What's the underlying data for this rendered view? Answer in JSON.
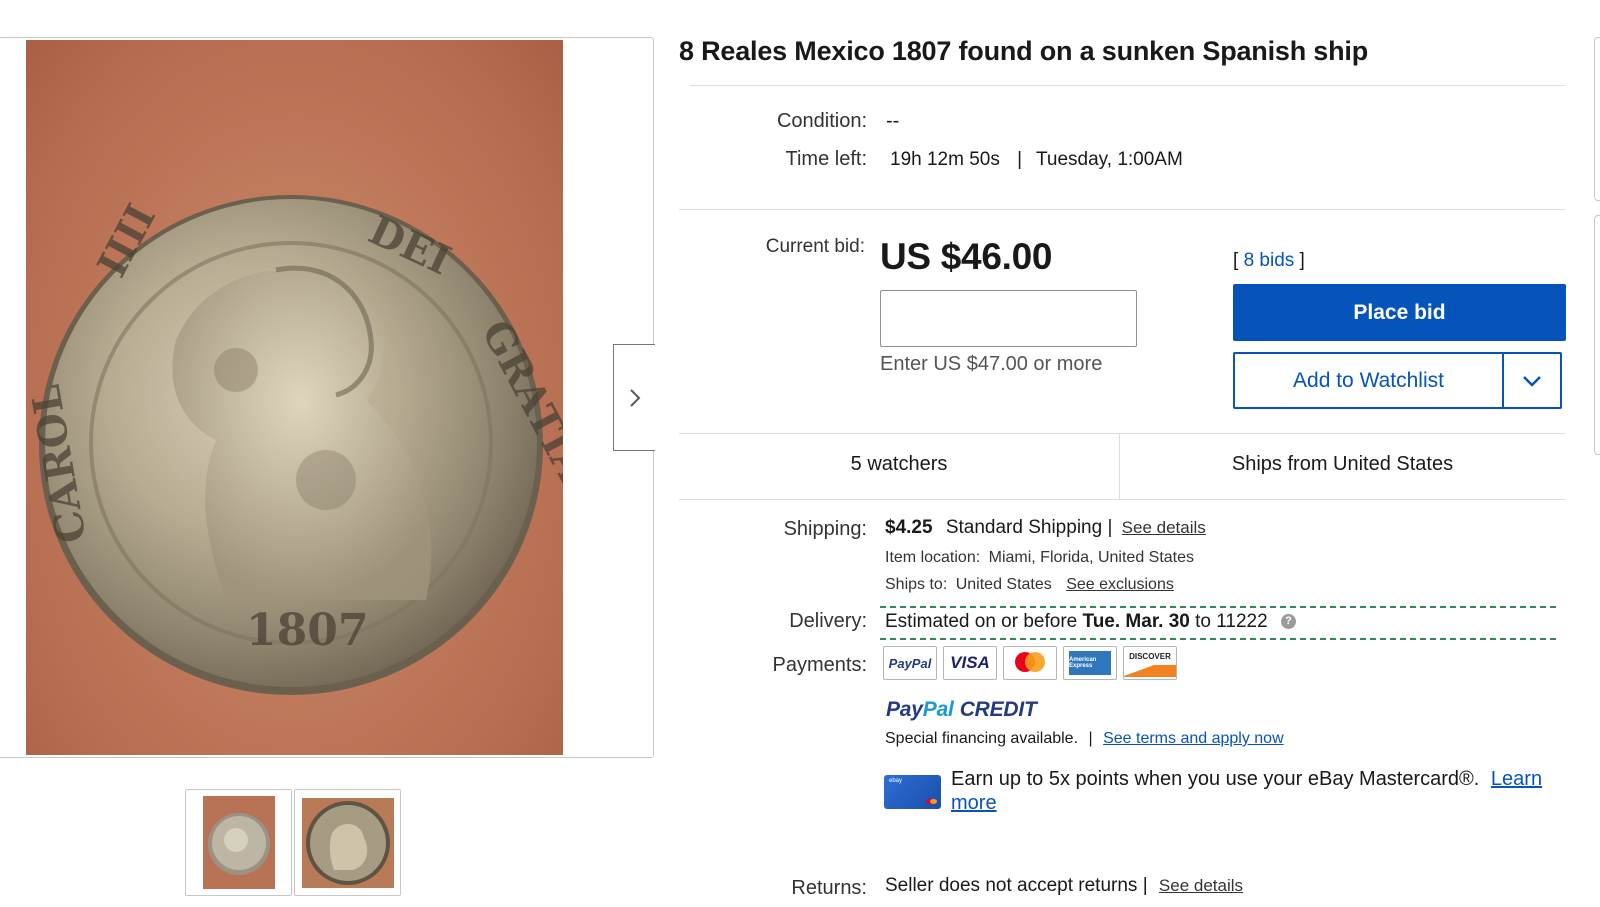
{
  "listing": {
    "title": "8 Reales Mexico 1807 found on a sunken Spanish ship"
  },
  "gallery": {
    "main_image": "coin-obverse-1807",
    "thumbnails": [
      "coin-reverse-thumb",
      "coin-obverse-thumb"
    ],
    "next_icon": "chevron-right-icon"
  },
  "details": {
    "condition_label": "Condition:",
    "condition_value": "--",
    "time_left_label": "Time left:",
    "time_left_value": "19h 12m 50s",
    "separator": "|",
    "end_time": "Tuesday, 1:00AM"
  },
  "bid": {
    "current_bid_label": "Current bid:",
    "price": "US $46.00",
    "bids_open": "[",
    "bids_count": "8 bids",
    "bids_close": "]",
    "input_value": "",
    "hint": "Enter US $47.00 or more",
    "place_bid_label": "Place bid",
    "watchlist_label": "Add to Watchlist",
    "watchlist_dropdown_icon": "chevron-down-icon"
  },
  "stats": {
    "watchers": "5 watchers",
    "ships_from": "Ships from United States"
  },
  "shipping": {
    "label": "Shipping:",
    "price": "$4.25",
    "method": "Standard Shipping",
    "sep": "|",
    "details_link": "See details",
    "item_location_label": "Item location:",
    "item_location": "Miami, Florida, United States",
    "ships_to_label": "Ships to:",
    "ships_to": "United States",
    "exclusions_link": "See exclusions"
  },
  "delivery": {
    "label": "Delivery:",
    "prefix": "Estimated on or before",
    "date": "Tue. Mar. 30",
    "suffix": "to 11222",
    "help_icon": "question-mark-icon",
    "help_glyph": "?"
  },
  "payments": {
    "label": "Payments:",
    "methods": [
      "PayPal",
      "VISA",
      "Mastercard",
      "American Express",
      "DISCOVER"
    ],
    "paypal_credit": {
      "pay": "Pay",
      "pal": "Pal",
      "credit": "CREDIT"
    },
    "financing_text": "Special financing available.",
    "financing_sep": "|",
    "financing_link": "See terms and apply now",
    "earn_text": "Earn up to 5x points when you use your eBay Mastercard®.",
    "learn_more_link": "Learn more",
    "card_icon": "ebay-mastercard-icon",
    "card_text": "ebay"
  },
  "returns": {
    "label": "Returns:",
    "value": "Seller does not accept returns",
    "sep": "|",
    "details_link": "See details"
  },
  "colors": {
    "brand_blue": "#0654ba",
    "delivery_dash": "#2e8b57"
  }
}
